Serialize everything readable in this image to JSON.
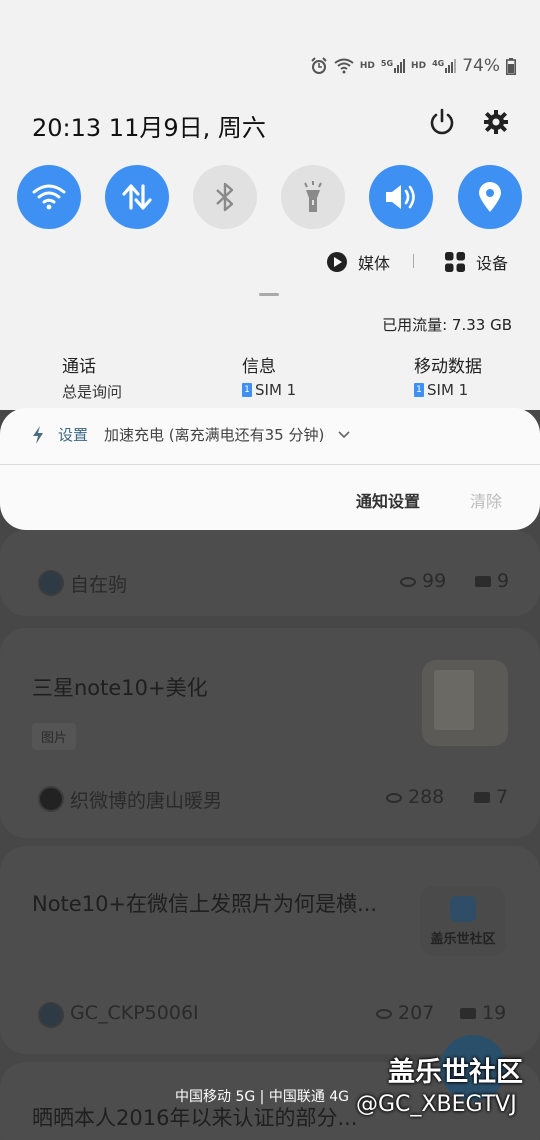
{
  "status_bar": {
    "battery": "74%",
    "hd1": "HD",
    "net1": "5G",
    "hd2": "HD",
    "net2": "4G"
  },
  "quick_panel": {
    "time_date": "20:13  11月9日, 周六",
    "media_label": "媒体",
    "devices_label": "设备",
    "data_usage": "已用流量: 7.33 GB",
    "sim_settings": [
      {
        "title": "通话",
        "value": "总是询问",
        "sim": ""
      },
      {
        "title": "信息",
        "value": "SIM 1",
        "sim": "1"
      },
      {
        "title": "移动数据",
        "value": "SIM 1",
        "sim": "1"
      }
    ],
    "tiles": [
      {
        "name": "wifi",
        "state": "on"
      },
      {
        "name": "mobile-data",
        "state": "on"
      },
      {
        "name": "bluetooth",
        "state": "off"
      },
      {
        "name": "flashlight",
        "state": "off"
      },
      {
        "name": "sound",
        "state": "on"
      },
      {
        "name": "location",
        "state": "on"
      }
    ]
  },
  "notification": {
    "app": "设置",
    "text": "加速充电 (离充满电还有35 分钟)",
    "settings_button": "通知设置",
    "clear_button": "清除"
  },
  "feed": {
    "posts": [
      {
        "author": "自在驹",
        "views": "99",
        "comments": "9"
      },
      {
        "title": "三星note10+美化",
        "tag": "图片",
        "author": "织微博的唐山暖男",
        "views": "288",
        "comments": "7"
      },
      {
        "title": "Note10+在微信上发照片为何是横...",
        "thumb_text": "盖乐世社区",
        "author": "GC_CKP5006I",
        "views": "207",
        "comments": "19"
      },
      {
        "title": "晒晒本人2016年以来认证的部分..."
      }
    ]
  },
  "carrier_text": "中国移动 5G | 中国联通 4G",
  "watermark": {
    "brand": "盖乐世社区",
    "handle": "@GC_XBEGTVJ"
  },
  "colors": {
    "accent": "#3e91f3",
    "shade_bg": "#f2f2f2",
    "tile_off": "#e1e1e1"
  }
}
